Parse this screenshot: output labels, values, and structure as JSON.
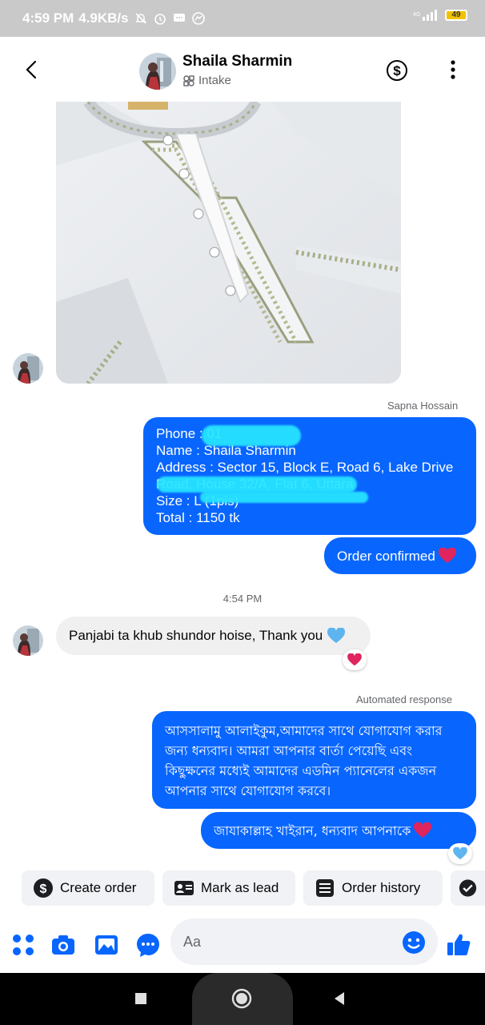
{
  "status_bar": {
    "time": "4:59 PM",
    "speed": "4.9KB/s",
    "battery": "49"
  },
  "header": {
    "name": "Shaila Sharmin",
    "subtitle": "Intake"
  },
  "messages": {
    "sender_label": "Sapna Hossain",
    "order_lines": [
      "Phone : 01",
      "Name : Shaila Sharmin",
      "Address : Sector 15, Block E, Road 6, Lake Drive",
      "Road, House 32/A, Flat 6, Uttara",
      "Size : L  (1pis)",
      "Total : 1150 tk"
    ],
    "order_confirmed": "Order confirmed",
    "timestamp": "4:54 PM",
    "incoming": "Panjabi ta khub shundor hoise, Thank you",
    "automated_label": "Automated response",
    "auto_reply": "আসসালামু আলাইকুম,আমাদের সাথে যোগাযোগ করার জন্য ধন্যবাদ। আমরা আপনার বার্তা পেয়েছি এবং কিছুক্ষনের মধ্যেই আমাদের এডমিন প্যানেলের একজন আপনার সাথে যোগাযোগ করবে।",
    "thanks_reply": "জাযাকাল্লাহ খাইরান, ধন্যবাদ আপনাকে"
  },
  "quick_actions": {
    "create_order": "Create order",
    "mark_as_lead": "Mark as lead",
    "order_history": "Order history"
  },
  "composer": {
    "placeholder": "Aa"
  },
  "colors": {
    "accent": "#0866ff",
    "bubble_in": "#f0f0f0",
    "heart": "#e0245e"
  }
}
